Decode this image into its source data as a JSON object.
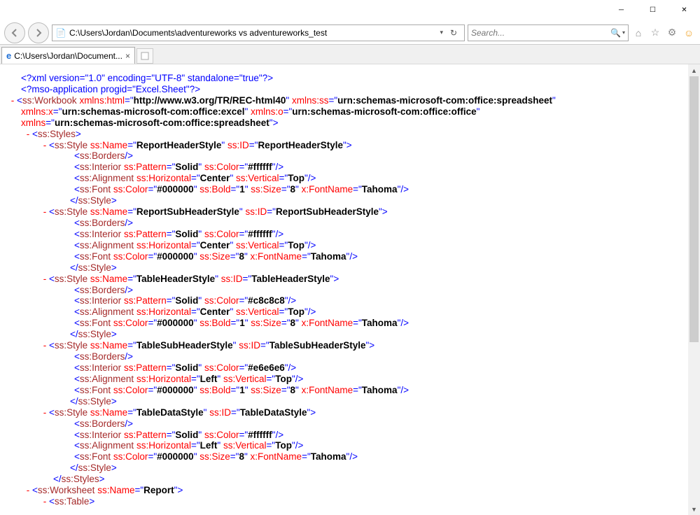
{
  "window": {
    "address": "C:\\Users\\Jordan\\Documents\\adventureworks vs adventureworks_test",
    "search_placeholder": "Search...",
    "tab_title": "C:\\Users\\Jordan\\Document..."
  },
  "xml": {
    "decl1": "<?xml version=\"1.0\" encoding=\"UTF-8\" standalone=\"true\"?>",
    "decl2": "<?mso-application progid=\"Excel.Sheet\"?>",
    "workbook": {
      "tag": "ss:Workbook",
      "attrs": [
        {
          "n": "xmlns:html",
          "v": "http://www.w3.org/TR/REC-html40"
        },
        {
          "n": "xmlns:ss",
          "v": "urn:schemas-microsoft-com:office:spreadsheet"
        }
      ],
      "attrs2": [
        {
          "n": "xmlns:x",
          "v": "urn:schemas-microsoft-com:office:excel"
        },
        {
          "n": "xmlns:o",
          "v": "urn:schemas-microsoft-com:office:office"
        }
      ],
      "attrs3": [
        {
          "n": "xmlns",
          "v": "urn:schemas-microsoft-com:office:spreadsheet"
        }
      ]
    },
    "styles_open": "ss:Styles",
    "styles": [
      {
        "style_attrs": [
          {
            "n": "ss:Name",
            "v": "ReportHeaderStyle"
          },
          {
            "n": "ss:ID",
            "v": "ReportHeaderStyle"
          }
        ],
        "interior": [
          {
            "n": "ss:Pattern",
            "v": "Solid"
          },
          {
            "n": "ss:Color",
            "v": "#ffffff"
          }
        ],
        "align": [
          {
            "n": "ss:Horizontal",
            "v": "Center"
          },
          {
            "n": "ss:Vertical",
            "v": "Top"
          }
        ],
        "font": [
          {
            "n": "ss:Color",
            "v": "#000000"
          },
          {
            "n": "ss:Bold",
            "v": "1"
          },
          {
            "n": "ss:Size",
            "v": "8"
          },
          {
            "n": "x:FontName",
            "v": "Tahoma"
          }
        ]
      },
      {
        "style_attrs": [
          {
            "n": "ss:Name",
            "v": "ReportSubHeaderStyle"
          },
          {
            "n": "ss:ID",
            "v": "ReportSubHeaderStyle"
          }
        ],
        "interior": [
          {
            "n": "ss:Pattern",
            "v": "Solid"
          },
          {
            "n": "ss:Color",
            "v": "#ffffff"
          }
        ],
        "align": [
          {
            "n": "ss:Horizontal",
            "v": "Center"
          },
          {
            "n": "ss:Vertical",
            "v": "Top"
          }
        ],
        "font": [
          {
            "n": "ss:Color",
            "v": "#000000"
          },
          {
            "n": "ss:Size",
            "v": "8"
          },
          {
            "n": "x:FontName",
            "v": "Tahoma"
          }
        ]
      },
      {
        "style_attrs": [
          {
            "n": "ss:Name",
            "v": "TableHeaderStyle"
          },
          {
            "n": "ss:ID",
            "v": "TableHeaderStyle"
          }
        ],
        "interior": [
          {
            "n": "ss:Pattern",
            "v": "Solid"
          },
          {
            "n": "ss:Color",
            "v": "#c8c8c8"
          }
        ],
        "align": [
          {
            "n": "ss:Horizontal",
            "v": "Center"
          },
          {
            "n": "ss:Vertical",
            "v": "Top"
          }
        ],
        "font": [
          {
            "n": "ss:Color",
            "v": "#000000"
          },
          {
            "n": "ss:Bold",
            "v": "1"
          },
          {
            "n": "ss:Size",
            "v": "8"
          },
          {
            "n": "x:FontName",
            "v": "Tahoma"
          }
        ]
      },
      {
        "style_attrs": [
          {
            "n": "ss:Name",
            "v": "TableSubHeaderStyle"
          },
          {
            "n": "ss:ID",
            "v": "TableSubHeaderStyle"
          }
        ],
        "interior": [
          {
            "n": "ss:Pattern",
            "v": "Solid"
          },
          {
            "n": "ss:Color",
            "v": "#e6e6e6"
          }
        ],
        "align": [
          {
            "n": "ss:Horizontal",
            "v": "Left"
          },
          {
            "n": "ss:Vertical",
            "v": "Top"
          }
        ],
        "font": [
          {
            "n": "ss:Color",
            "v": "#000000"
          },
          {
            "n": "ss:Bold",
            "v": "1"
          },
          {
            "n": "ss:Size",
            "v": "8"
          },
          {
            "n": "x:FontName",
            "v": "Tahoma"
          }
        ]
      },
      {
        "style_attrs": [
          {
            "n": "ss:Name",
            "v": "TableDataStyle"
          },
          {
            "n": "ss:ID",
            "v": "TableDataStyle"
          }
        ],
        "interior": [
          {
            "n": "ss:Pattern",
            "v": "Solid"
          },
          {
            "n": "ss:Color",
            "v": "#ffffff"
          }
        ],
        "align": [
          {
            "n": "ss:Horizontal",
            "v": "Left"
          },
          {
            "n": "ss:Vertical",
            "v": "Top"
          }
        ],
        "font": [
          {
            "n": "ss:Color",
            "v": "#000000"
          },
          {
            "n": "ss:Size",
            "v": "8"
          },
          {
            "n": "x:FontName",
            "v": "Tahoma"
          }
        ]
      }
    ],
    "worksheet_attrs": [
      {
        "n": "ss:Name",
        "v": "Report"
      }
    ],
    "table_tag": "ss:Table"
  }
}
